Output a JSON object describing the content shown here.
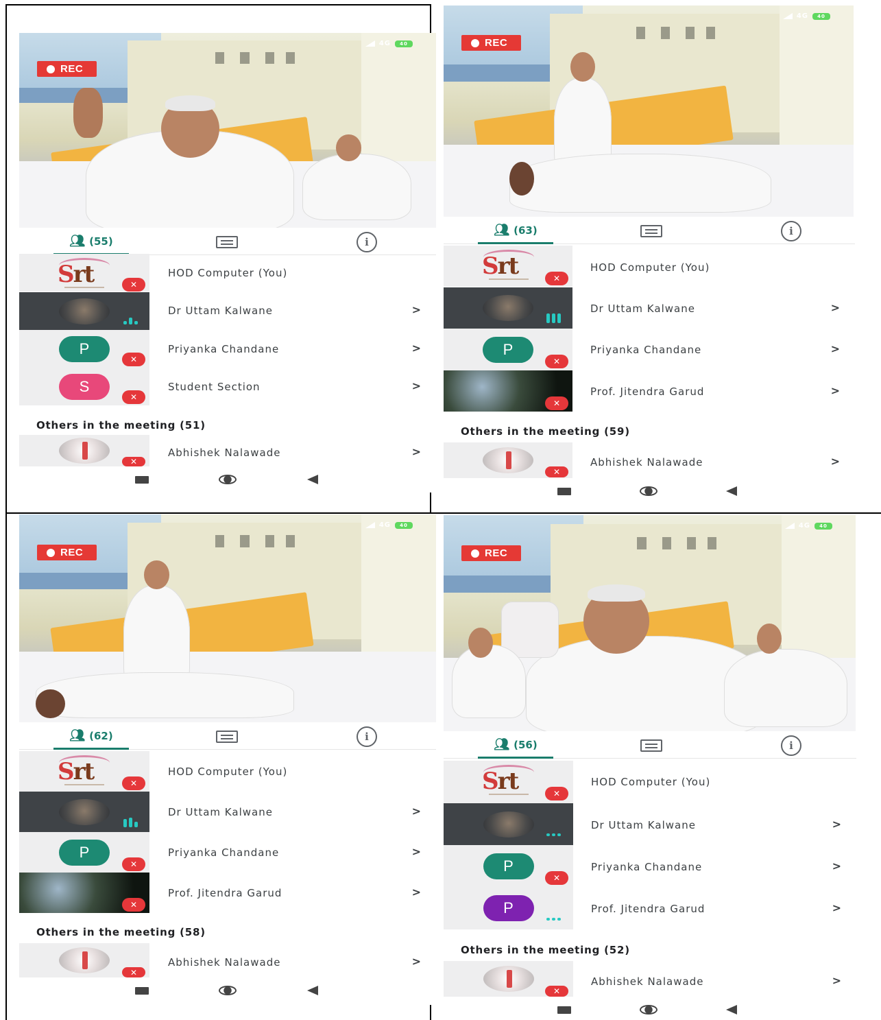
{
  "colors": {
    "accent": "#1a7d6c",
    "rec": "#e53935",
    "mute": "#e5373a",
    "speaking": "#27c9c2",
    "avatar_teal": "#1d8a73",
    "avatar_pink": "#e8487a",
    "avatar_purple": "#7e22b0"
  },
  "status_bar": {
    "network": "4G",
    "battery": "40"
  },
  "rec_label": "REC",
  "panels": [
    {
      "participant_count": "(55)",
      "participants": [
        {
          "name": "HOD Computer (You)",
          "avatar": "srt-logo",
          "muted": true,
          "has_chevron": false
        },
        {
          "name": "Dr Uttam Kalwane",
          "avatar": "video-circle",
          "muted": false,
          "has_chevron": true
        },
        {
          "name": "Priyanka Chandane",
          "avatar": "letter",
          "letter": "P",
          "muted": true,
          "has_chevron": true
        },
        {
          "name": "Student Section",
          "avatar": "letter",
          "letter": "S",
          "muted": true,
          "has_chevron": true
        }
      ],
      "others_label": "Others in the meeting (51)",
      "others": [
        {
          "name": "Abhishek Nalawade",
          "muted": true,
          "has_chevron": true
        }
      ]
    },
    {
      "participant_count": "(63)",
      "participants": [
        {
          "name": "HOD Computer (You)",
          "avatar": "srt-logo",
          "muted": true,
          "has_chevron": false
        },
        {
          "name": "Dr Uttam Kalwane",
          "avatar": "video-circle",
          "muted": false,
          "has_chevron": true
        },
        {
          "name": "Priyanka Chandane",
          "avatar": "letter",
          "letter": "P",
          "muted": true,
          "has_chevron": true
        },
        {
          "name": "Prof. Jitendra Garud",
          "avatar": "video",
          "muted": true,
          "has_chevron": true
        }
      ],
      "others_label": "Others in the meeting (59)",
      "others": [
        {
          "name": "Abhishek Nalawade",
          "muted": true,
          "has_chevron": true
        }
      ]
    },
    {
      "participant_count": "(62)",
      "participants": [
        {
          "name": "HOD Computer (You)",
          "avatar": "srt-logo",
          "muted": true,
          "has_chevron": false
        },
        {
          "name": "Dr Uttam Kalwane",
          "avatar": "video-circle",
          "muted": false,
          "has_chevron": true
        },
        {
          "name": "Priyanka Chandane",
          "avatar": "letter",
          "letter": "P",
          "muted": true,
          "has_chevron": true
        },
        {
          "name": "Prof. Jitendra Garud",
          "avatar": "video",
          "muted": true,
          "has_chevron": true
        }
      ],
      "others_label": "Others in the meeting (58)",
      "others": [
        {
          "name": "Abhishek Nalawade",
          "muted": true,
          "has_chevron": true
        }
      ]
    },
    {
      "participant_count": "(56)",
      "participants": [
        {
          "name": "HOD Computer (You)",
          "avatar": "srt-logo",
          "muted": true,
          "has_chevron": false
        },
        {
          "name": "Dr Uttam Kalwane",
          "avatar": "video-circle",
          "muted": false,
          "has_chevron": true
        },
        {
          "name": "Priyanka Chandane",
          "avatar": "letter",
          "letter": "P",
          "muted": true,
          "has_chevron": true
        },
        {
          "name": "Prof. Jitendra Garud",
          "avatar": "letter",
          "letter": "P",
          "muted": false,
          "has_chevron": true
        }
      ],
      "others_label": "Others in the meeting (52)",
      "others": [
        {
          "name": "Abhishek Nalawade",
          "muted": true,
          "has_chevron": true
        }
      ]
    }
  ]
}
